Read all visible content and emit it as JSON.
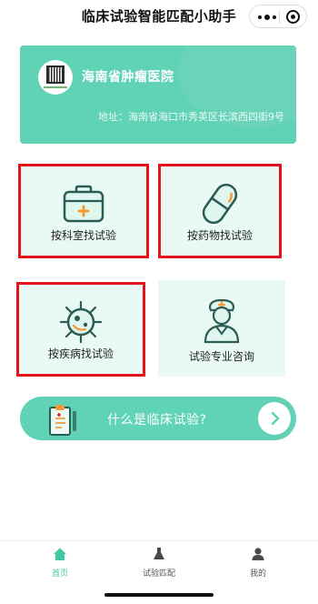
{
  "nav": {
    "title": "临床试验智能匹配小助手"
  },
  "hospital": {
    "name": "海南省肿瘤医院",
    "address": "地址：海南省海口市秀英区长滨西四街9号"
  },
  "cards": [
    {
      "label": "按科室找试验",
      "icon": "medical-kit-icon"
    },
    {
      "label": "按药物找试验",
      "icon": "capsule-icon"
    },
    {
      "label": "按疾病找试验",
      "icon": "virus-icon"
    },
    {
      "label": "试验专业咨询",
      "icon": "nurse-icon"
    }
  ],
  "banner": {
    "text": "什么是临床试验?",
    "icon": "clipboard-icon"
  },
  "tabs": [
    {
      "label": "首页",
      "icon": "home-icon",
      "active": true
    },
    {
      "label": "试验匹配",
      "icon": "flask-icon",
      "active": false
    },
    {
      "label": "我的",
      "icon": "user-icon",
      "active": false
    }
  ],
  "colors": {
    "accent": "#60d2b5",
    "card_bg": "#e9faf5",
    "highlight": "#e3141b",
    "orange": "#f59a3a"
  }
}
